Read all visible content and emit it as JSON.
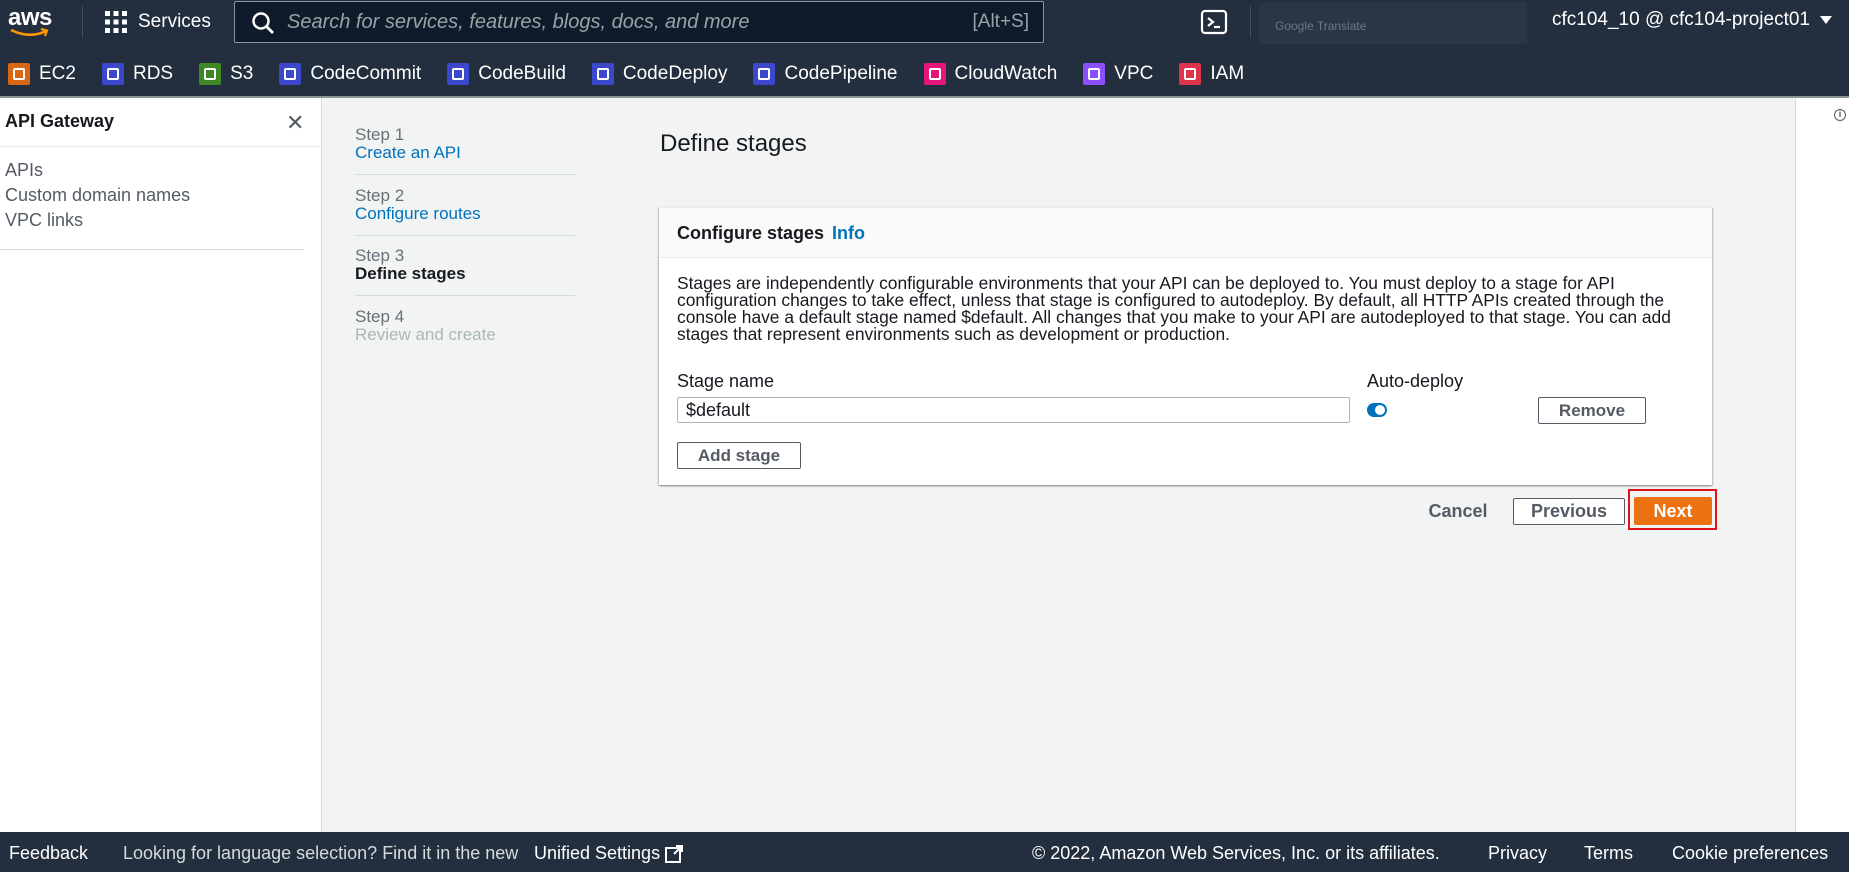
{
  "topnav": {
    "logo_text": "aws",
    "services_label": "Services",
    "search_placeholder": "Search for services, features, blogs, docs, and more",
    "search_shortcut": "[Alt+S]",
    "google_translate_label": "Google Translate",
    "account_label": "cfc104_10 @ cfc104-project01"
  },
  "favorites": [
    {
      "label": "EC2",
      "color": "#d86613"
    },
    {
      "label": "RDS",
      "color": "#3b48cc"
    },
    {
      "label": "S3",
      "color": "#3f8624"
    },
    {
      "label": "CodeCommit",
      "color": "#3b48cc"
    },
    {
      "label": "CodeBuild",
      "color": "#3b48cc"
    },
    {
      "label": "CodeDeploy",
      "color": "#3b48cc"
    },
    {
      "label": "CodePipeline",
      "color": "#3b48cc"
    },
    {
      "label": "CloudWatch",
      "color": "#e7157b"
    },
    {
      "label": "VPC",
      "color": "#8c4fff"
    },
    {
      "label": "IAM",
      "color": "#dd344c"
    }
  ],
  "sidenav": {
    "title": "API Gateway",
    "items": [
      "APIs",
      "Custom domain names",
      "VPC links"
    ]
  },
  "wizard": {
    "steps": [
      {
        "num": "Step 1",
        "name": "Create an API",
        "state": "link"
      },
      {
        "num": "Step 2",
        "name": "Configure routes",
        "state": "link"
      },
      {
        "num": "Step 3",
        "name": "Define stages",
        "state": "current"
      },
      {
        "num": "Step 4",
        "name": "Review and create",
        "state": "disabled"
      }
    ]
  },
  "main": {
    "page_title": "Define stages",
    "panel": {
      "header": "Configure stages",
      "info_link": "Info",
      "description": "Stages are independently configurable environments that your API can be deployed to. You must deploy to a stage for API configuration changes to take effect, unless that stage is configured to autodeploy. By default, all HTTP APIs created through the console have a default stage named $default. All changes that you make to your API are autodeployed to that stage. You can add stages that represent environments such as development or production.",
      "stage_name_label": "Stage name",
      "auto_deploy_label": "Auto-deploy",
      "stage_name_value": "$default",
      "auto_deploy_enabled": true,
      "remove_label": "Remove",
      "add_stage_label": "Add stage"
    },
    "actions": {
      "cancel": "Cancel",
      "previous": "Previous",
      "next": "Next"
    }
  },
  "footer": {
    "feedback": "Feedback",
    "language_prompt": "Looking for language selection? Find it in the new",
    "unified_settings": "Unified Settings",
    "copyright": "© 2022, Amazon Web Services, Inc. or its affiliates.",
    "privacy": "Privacy",
    "terms": "Terms",
    "cookie_preferences": "Cookie preferences"
  },
  "colors": {
    "nav_bg": "#232f3e",
    "link": "#0073bb",
    "primary_button": "#ec7211",
    "highlight": "#e0121b"
  }
}
